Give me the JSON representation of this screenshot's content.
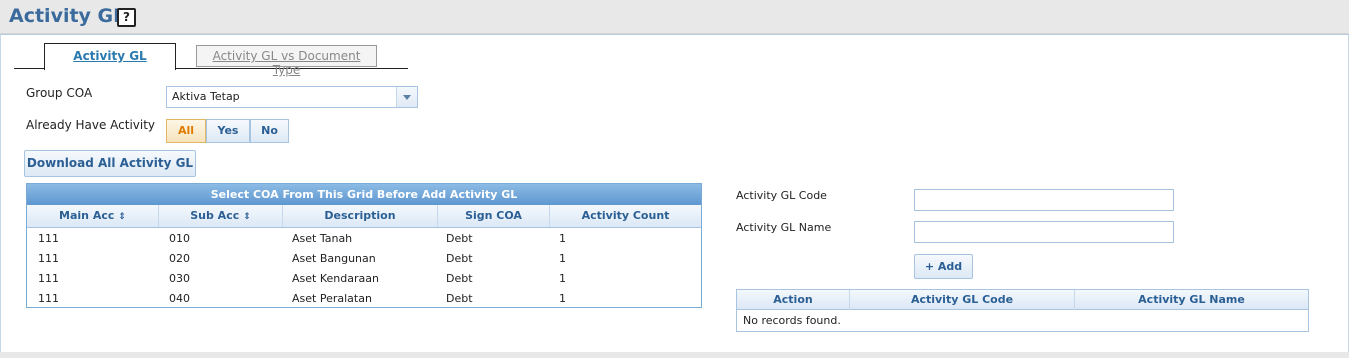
{
  "header": {
    "title": "Activity GL",
    "help_glyph": "?"
  },
  "tabs": [
    {
      "label": "Activity GL",
      "active": true
    },
    {
      "label": "Activity GL vs Document Type",
      "active": false
    }
  ],
  "filters": {
    "group_coa_label": "Group COA",
    "group_coa_value": "Aktiva Tetap",
    "already_have_activity_label": "Already Have Activity",
    "activity_options": [
      "All",
      "Yes",
      "No"
    ],
    "activity_selected": "All"
  },
  "download_button": "Download All Activity GL",
  "coa_grid": {
    "caption": "Select COA From This Grid Before Add Activity GL",
    "columns": [
      "Main Acc",
      "Sub Acc",
      "Description",
      "Sign COA",
      "Activity Count"
    ],
    "rows": [
      [
        "111",
        "010",
        "Aset Tanah",
        "Debt",
        "1"
      ],
      [
        "111",
        "020",
        "Aset Bangunan",
        "Debt",
        "1"
      ],
      [
        "111",
        "030",
        "Aset Kendaraan",
        "Debt",
        "1"
      ],
      [
        "111",
        "040",
        "Aset Peralatan",
        "Debt",
        "1"
      ]
    ]
  },
  "form": {
    "code_label": "Activity GL Code",
    "code_value": "",
    "name_label": "Activity GL Name",
    "name_value": "",
    "add_button": "Add",
    "add_icon": "+"
  },
  "activity_grid": {
    "columns": [
      "Action",
      "Activity GL Code",
      "Activity GL Name"
    ],
    "empty_message": "No records found."
  },
  "colors": {
    "accent": "#3b6a9c",
    "caption_bg": "#5e97cf",
    "active_seg": "#e07b00"
  }
}
